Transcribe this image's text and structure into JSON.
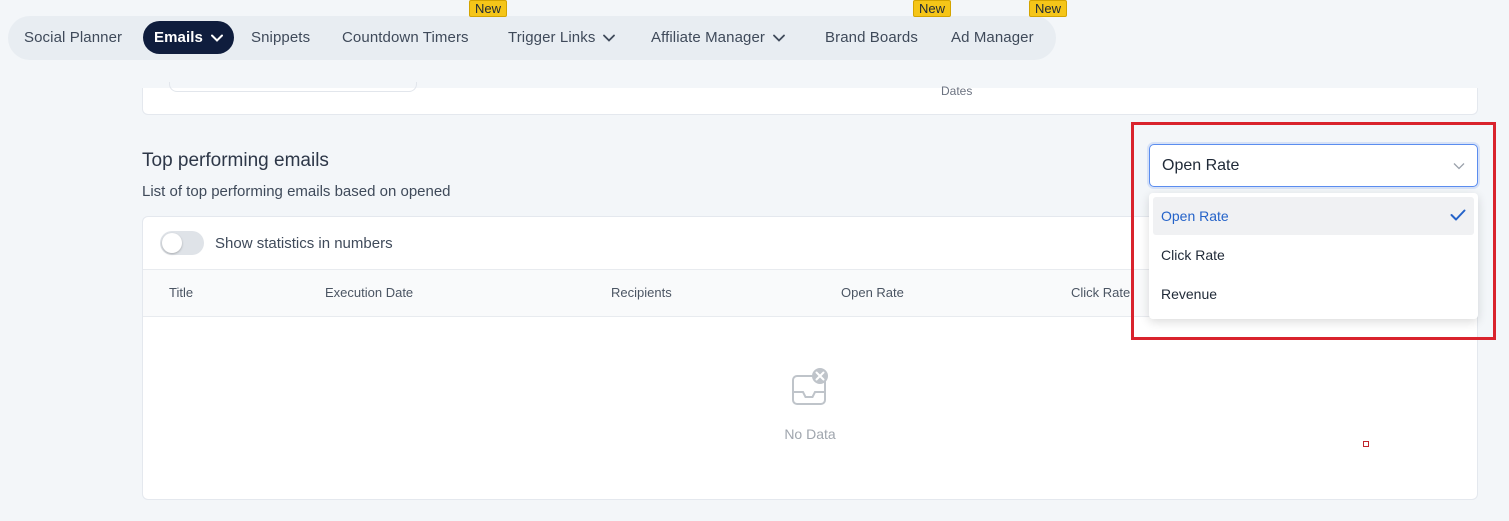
{
  "nav": {
    "items": [
      {
        "label": "Social Planner",
        "has_dropdown": false,
        "badge": ""
      },
      {
        "label": "Emails",
        "has_dropdown": true,
        "badge": "",
        "active": true
      },
      {
        "label": "Snippets",
        "has_dropdown": false,
        "badge": "New"
      },
      {
        "label": "Countdown Timers",
        "has_dropdown": false,
        "badge": ""
      },
      {
        "label": "Trigger Links",
        "has_dropdown": true,
        "badge": ""
      },
      {
        "label": "Affiliate Manager",
        "has_dropdown": true,
        "badge": ""
      },
      {
        "label": "Brand Boards",
        "has_dropdown": false,
        "badge": "New"
      },
      {
        "label": "Ad Manager",
        "has_dropdown": false,
        "badge": "New"
      }
    ],
    "badge_label": "New"
  },
  "upper_card": {
    "axis_label": "Dates"
  },
  "section": {
    "title": "Top performing emails",
    "subtitle": "List of top performing emails based on opened"
  },
  "table": {
    "toggle_label": "Show statistics in numbers",
    "toggle_on": false,
    "columns": [
      "Title",
      "Execution Date",
      "Recipients",
      "Open Rate",
      "Click Rate"
    ],
    "rows": [],
    "empty_label": "No Data"
  },
  "metric_select": {
    "value": "Open Rate",
    "options": [
      {
        "label": "Open Rate",
        "selected": true
      },
      {
        "label": "Click Rate",
        "selected": false
      },
      {
        "label": "Revenue",
        "selected": false
      }
    ]
  },
  "colors": {
    "accent": "#2563c9",
    "nav_active_bg": "#0f1d3d",
    "badge_bg": "#f5c518",
    "highlight": "#d9232d"
  }
}
